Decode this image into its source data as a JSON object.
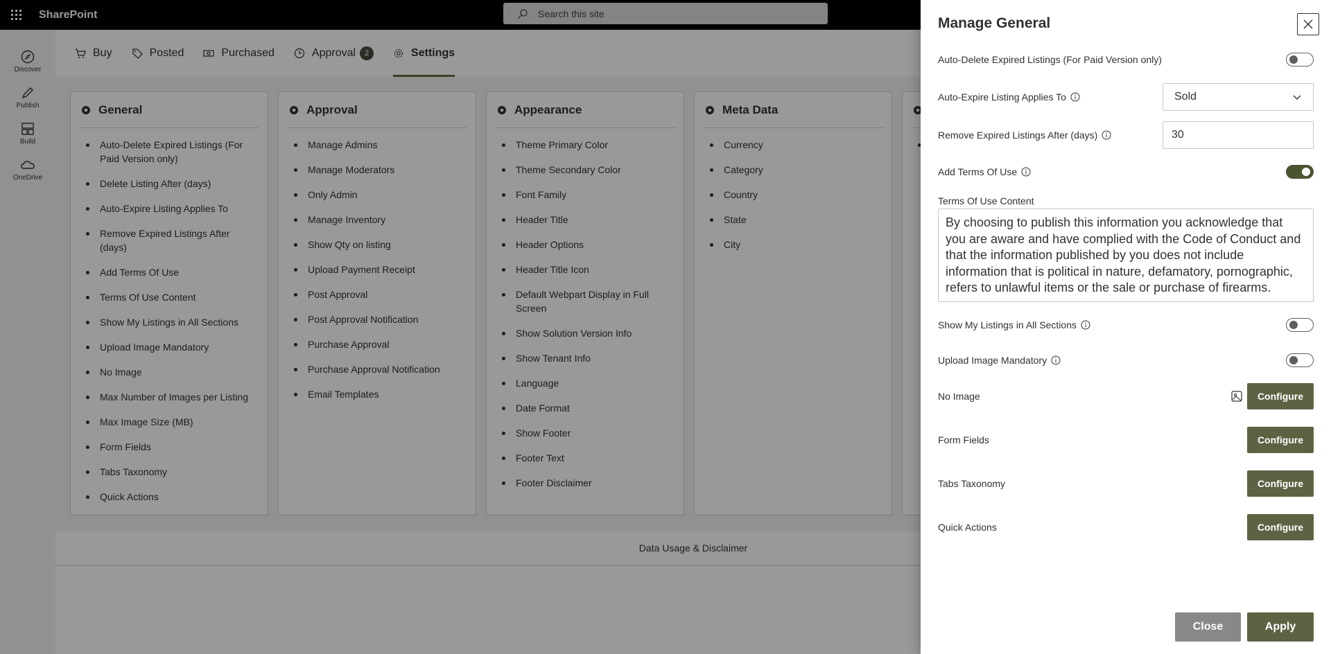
{
  "suite": {
    "app_name": "SharePoint",
    "search_placeholder": "Search this site"
  },
  "appbar": [
    {
      "label": "Discover",
      "icon": "discover-icon"
    },
    {
      "label": "Publish",
      "icon": "publish-icon"
    },
    {
      "label": "Build",
      "icon": "build-icon"
    },
    {
      "label": "OneDrive",
      "icon": "onedrive-icon"
    }
  ],
  "tabs": [
    {
      "label": "Buy",
      "icon": "cart-icon"
    },
    {
      "label": "Posted",
      "icon": "tag-icon"
    },
    {
      "label": "Purchased",
      "icon": "money-icon"
    },
    {
      "label": "Approval",
      "icon": "clock-icon",
      "badge": "2"
    },
    {
      "label": "Settings",
      "icon": "gear-icon",
      "active": true
    }
  ],
  "cards": [
    {
      "title": "General",
      "items": [
        "Auto-Delete Expired Listings (For Paid Version only)",
        "Delete Listing After (days)",
        "Auto-Expire Listing Applies To",
        "Remove Expired Listings After (days)",
        "Add Terms Of Use",
        "Terms Of Use Content",
        "Show My Listings in All Sections",
        "Upload Image Mandatory",
        "No Image",
        "Max Number of Images per Listing",
        "Max Image Size (MB)",
        "Form Fields",
        "Tabs Taxonomy",
        "Quick Actions"
      ]
    },
    {
      "title": "Approval",
      "items": [
        "Manage Admins",
        "Manage Moderators",
        "Only Admin",
        "Manage Inventory",
        "Show Qty on listing",
        "Upload Payment Receipt",
        "Post Approval",
        "Post Approval Notification",
        "Purchase Approval",
        "Purchase Approval Notification",
        "Email Templates"
      ]
    },
    {
      "title": "Appearance",
      "items": [
        "Theme Primary Color",
        "Theme Secondary Color",
        "Font Family",
        "Header Title",
        "Header Options",
        "Header Title Icon",
        "Default Webpart Display in Full Screen",
        "Show Solution Version Info",
        "Show Tenant Info",
        "Language",
        "Date Format",
        "Show Footer",
        "Footer Text",
        "Footer Disclaimer"
      ]
    },
    {
      "title": "Meta Data",
      "items": [
        "Currency",
        "Category",
        "Country",
        "State",
        "City"
      ]
    },
    {
      "title": "",
      "items": [
        ""
      ]
    }
  ],
  "footer_link": "Data Usage & Disclaimer",
  "panel": {
    "title": "Manage General",
    "auto_delete": {
      "label": "Auto-Delete Expired Listings (For Paid Version only)",
      "on": false
    },
    "auto_expire": {
      "label": "Auto-Expire Listing Applies To",
      "value": "Sold"
    },
    "remove_after": {
      "label": "Remove Expired Listings After (days)",
      "value": "30"
    },
    "add_terms": {
      "label": "Add Terms Of Use",
      "on": true
    },
    "terms_content": {
      "label": "Terms Of Use Content",
      "value": "By choosing to publish this information you acknowledge that you are aware and have complied with the Code of Conduct and that the information published by you does not include information that is political in nature, defamatory, pornographic, refers to unlawful items or the sale or purchase of firearms."
    },
    "show_my_listings": {
      "label": "Show My Listings in All Sections",
      "on": false
    },
    "upload_mandatory": {
      "label": "Upload Image Mandatory",
      "on": false
    },
    "no_image": {
      "label": "No Image",
      "button": "Configure"
    },
    "form_fields": {
      "label": "Form Fields",
      "button": "Configure"
    },
    "tabs_taxonomy": {
      "label": "Tabs Taxonomy",
      "button": "Configure"
    },
    "quick_actions": {
      "label": "Quick Actions",
      "button": "Configure"
    },
    "close_label": "Close",
    "apply_label": "Apply"
  },
  "colors": {
    "accent": "#5b6343",
    "toggle_on": "#4a5530",
    "overlay": "rgba(0,0,0,0.4)"
  }
}
